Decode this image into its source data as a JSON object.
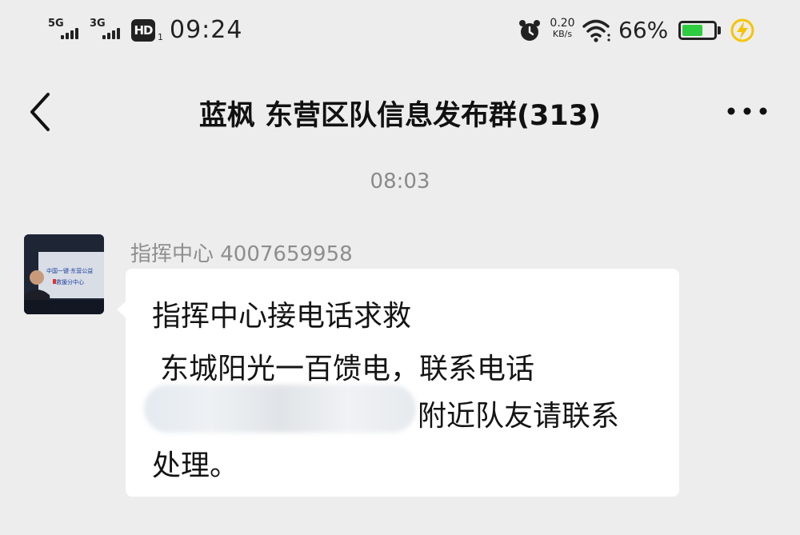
{
  "status_bar": {
    "network1": "5G",
    "network2": "3G",
    "hd_badge": "HD",
    "hd_sub": "1",
    "time": "09:24",
    "net_speed_value": "0.20",
    "net_speed_unit": "KB/s",
    "battery_percent": "66%",
    "battery_level": 0.66,
    "icons": [
      "signal-icon",
      "signal-icon",
      "hd-icon",
      "alarm-icon",
      "wifi-icon",
      "battery-icon",
      "charging-icon"
    ],
    "colors": {
      "battery_fill": "#2ecc40",
      "charge_bolt": "#f5c400"
    }
  },
  "nav": {
    "back_icon": "back-chevron-icon",
    "title": "蓝枫 东营区队信息发布群(313)",
    "more_icon": "more-dots-icon"
  },
  "chat": {
    "timestamp": "08:03",
    "message": {
      "sender": "指挥中心 4007659958",
      "avatar_caption_line1": "中国一键·东营公益",
      "avatar_caption_line2": "救援分中心",
      "lines": [
        "指挥中心接电话求救",
        "东城阳光一百馈电，联系电话",
        "附近队友请联系",
        "处理。"
      ],
      "redacted": true
    }
  }
}
